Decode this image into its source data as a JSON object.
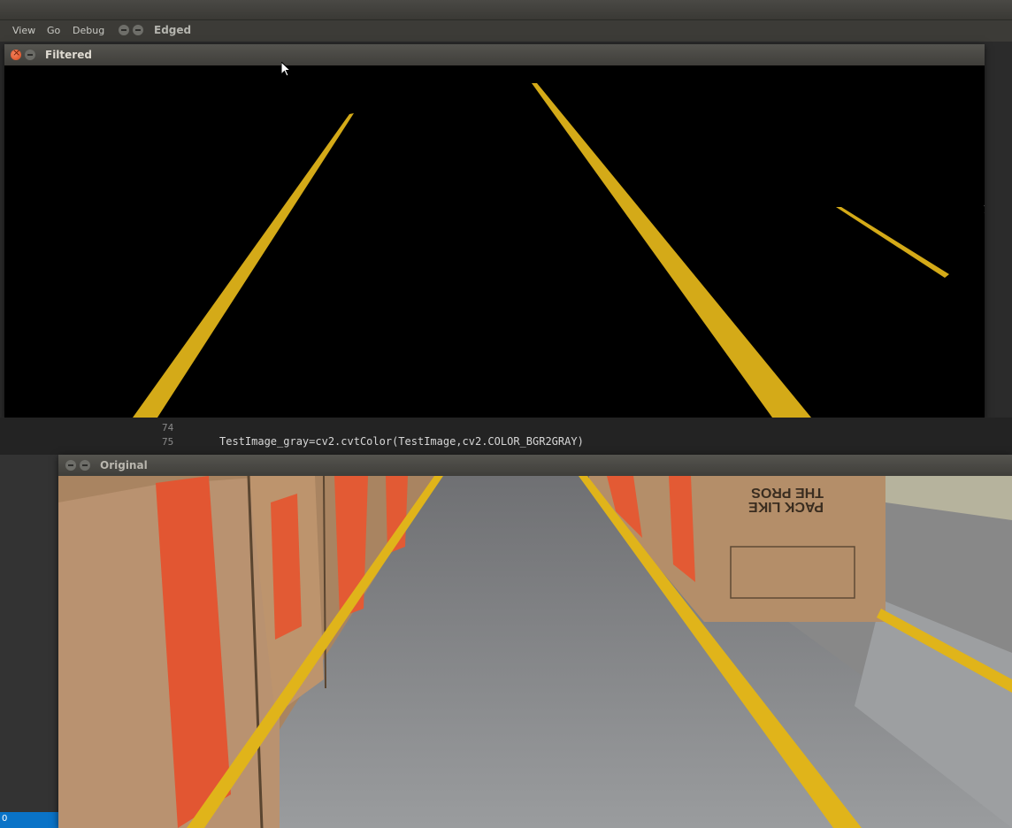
{
  "menubar": {
    "items": [
      "View",
      "Go",
      "Debug"
    ]
  },
  "background_window": {
    "title": "Edged"
  },
  "filtered_window": {
    "title": "Filtered"
  },
  "original_window": {
    "title": "Original"
  },
  "editor": {
    "lines": [
      {
        "number": "74",
        "code": ""
      },
      {
        "number": "75",
        "code": "TestImage_gray=cv2.cvtColor(TestImage,cv2.COLOR_BGR2GRAY)"
      }
    ]
  },
  "statusbar": {
    "text": "0"
  },
  "colors": {
    "lane_yellow": "#e0b41a",
    "lane_yellow_dark": "#c79a10",
    "carpet": "#8b8d90",
    "cardboard": "#b08a65",
    "accent_orange": "#e35a33",
    "status_blue": "#0a73c7"
  },
  "icons": [
    "close-icon",
    "minimize-icon",
    "mouse-pointer-icon"
  ],
  "box_print": {
    "line1": "THE PROS",
    "line2": "PACK LIKE"
  }
}
